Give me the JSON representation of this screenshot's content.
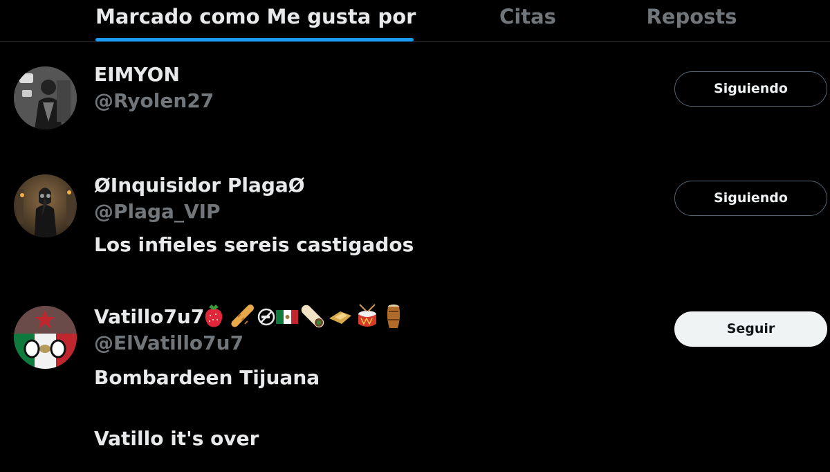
{
  "tabs": [
    {
      "label": "Marcado como Me gusta por",
      "active": true
    },
    {
      "label": "Citas",
      "active": false
    },
    {
      "label": "Reposts",
      "active": false
    }
  ],
  "users": [
    {
      "display_name": "EIMYON",
      "handle": "@Ryolen27",
      "bio": "",
      "button_label": "Siguiendo",
      "following": true
    },
    {
      "display_name": "ØInquisidor PlagaØ",
      "handle": "@Plaga_VIP",
      "bio": "Los infieles sereis castigados",
      "button_label": "Siguiendo",
      "following": true
    },
    {
      "display_name": "Vatillo7u7",
      "display_name_emojis": [
        "strawberry-icon",
        "baguette-icon",
        "no-smoking-icon",
        "mexico-flag-icon",
        "burrito-icon",
        "tamale-icon",
        "drum-icon",
        "conga-drum-icon"
      ],
      "handle": "@ElVatillo7u7",
      "bio": "Bombardeen Tijuana",
      "bio_line2": "Vatillo it's over",
      "button_label": "Seguir",
      "following": false
    }
  ],
  "colors": {
    "background": "#000000",
    "accent": "#1d9bf0",
    "text_primary": "#e7e9ea",
    "text_secondary": "#71767b",
    "divider": "#2f3336"
  }
}
